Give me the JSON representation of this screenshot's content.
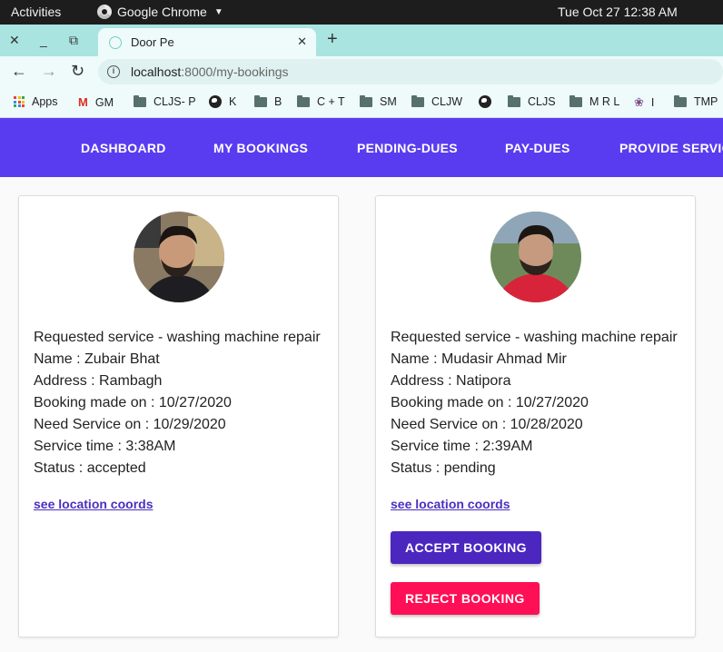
{
  "system_bar": {
    "activities": "Activities",
    "app_name": "Google Chrome",
    "clock": "Tue Oct 27  12:38 AM"
  },
  "browser": {
    "tab_title": "Door Pe",
    "url_host": "localhost",
    "url_path": ":8000/my-bookings",
    "bookmarks": [
      {
        "label": "Apps",
        "icon": "apps-icon"
      },
      {
        "label": "GM",
        "icon": "gmail-icon"
      },
      {
        "label": "CLJS- P",
        "icon": "folder-icon"
      },
      {
        "label": "K",
        "icon": "globe-icon"
      },
      {
        "label": "B",
        "icon": "folder-icon"
      },
      {
        "label": "C + T",
        "icon": "folder-icon"
      },
      {
        "label": "SM",
        "icon": "folder-icon"
      },
      {
        "label": "CLJW",
        "icon": "folder-icon"
      },
      {
        "label": "",
        "icon": "globe-icon"
      },
      {
        "label": "CLJS",
        "icon": "folder-icon"
      },
      {
        "label": "M R L",
        "icon": "folder-icon"
      },
      {
        "label": "I",
        "icon": "lotus-icon"
      },
      {
        "label": "TMP",
        "icon": "folder-icon"
      }
    ]
  },
  "nav": {
    "items": [
      "DASHBOARD",
      "MY BOOKINGS",
      "PENDING-DUES",
      "PAY-DUES",
      "PROVIDE SERVIC"
    ]
  },
  "bookings": [
    {
      "service": "Requested service - washing machine repair",
      "name": "Name : Zubair Bhat",
      "address": "Address : Rambagh",
      "booking_made": "Booking made on : 10/27/2020",
      "need_service": "Need Service on : 10/29/2020",
      "service_time": "Service time : 3:38AM",
      "status": "Status : accepted",
      "location_link": "see location coords"
    },
    {
      "service": "Requested service - washing machine repair",
      "name": "Name : Mudasir Ahmad Mir",
      "address": "Address : Natipora",
      "booking_made": "Booking made on : 10/27/2020",
      "need_service": "Need Service on : 10/28/2020",
      "service_time": "Service time : 2:39AM",
      "status": "Status : pending",
      "location_link": "see location coords",
      "accept_label": "ACCEPT BOOKING",
      "reject_label": "REJECT BOOKING"
    }
  ],
  "colors": {
    "navbar": "#5a3cf0",
    "accept": "#4b27c0",
    "reject": "#ff0f55",
    "link": "#4b2fc0",
    "tabstrip": "#a9e4e0"
  }
}
